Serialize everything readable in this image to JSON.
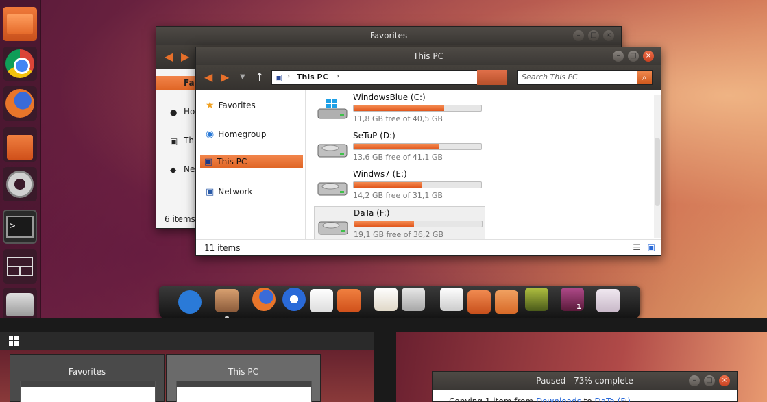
{
  "colors": {
    "accent": "#E8702A",
    "titlebar": "#3B3835"
  },
  "launcher": {
    "items": [
      {
        "name": "files-icon"
      },
      {
        "name": "chrome-icon"
      },
      {
        "name": "firefox-icon"
      },
      {
        "name": "store-icon"
      },
      {
        "name": "settings-icon"
      },
      {
        "name": "terminal-icon",
        "glyph": ">_"
      },
      {
        "name": "workspace-switcher-icon"
      },
      {
        "name": "drive-icon"
      }
    ]
  },
  "favorites_window": {
    "title": "Favorites",
    "sidebar": [
      "Fav",
      "Ho",
      "Thi",
      "Ne"
    ],
    "status": "6 items"
  },
  "this_pc_window": {
    "title": "This PC",
    "address": "This PC",
    "search_placeholder": "Search This PC",
    "nav": {
      "favorites": "Favorites",
      "homegroup": "Homegroup",
      "this_pc": "This PC",
      "network": "Network"
    },
    "drives": [
      {
        "name": "WindowsBlue (C:)",
        "free": "11,8 GB free of 40,5 GB",
        "used_fraction": 0.71
      },
      {
        "name": "SeTuP (D:)",
        "free": "13,6 GB free of 41,1 GB",
        "used_fraction": 0.67
      },
      {
        "name": "Windws7 (E:)",
        "free": "14,2 GB free of 31,1 GB",
        "used_fraction": 0.54
      },
      {
        "name": "DaTa (F:)",
        "free": "19,1 GB free of 36,2 GB",
        "used_fraction": 0.47
      }
    ],
    "status": "11 items"
  },
  "dock": {
    "items": [
      "accessibility-icon",
      "archive-icon",
      "firefox-icon",
      "thunderbird-icon",
      "chat-icon",
      "store-icon",
      "notes-icon",
      "calculator-icon",
      "editor-icon",
      "backup-icon",
      "downloads-icon",
      "photos-icon",
      "workspaces-icon",
      "presentation-icon"
    ],
    "badge": "1"
  },
  "switcher": {
    "cards": [
      {
        "title": "Favorites"
      },
      {
        "title": "This PC"
      }
    ]
  },
  "copy_dialog": {
    "title": "Paused - 73% complete",
    "body_prefix": "Copying 1 item from ",
    "source": "Downloads",
    "body_mid": " to ",
    "destination": "DaTa (F:)"
  }
}
